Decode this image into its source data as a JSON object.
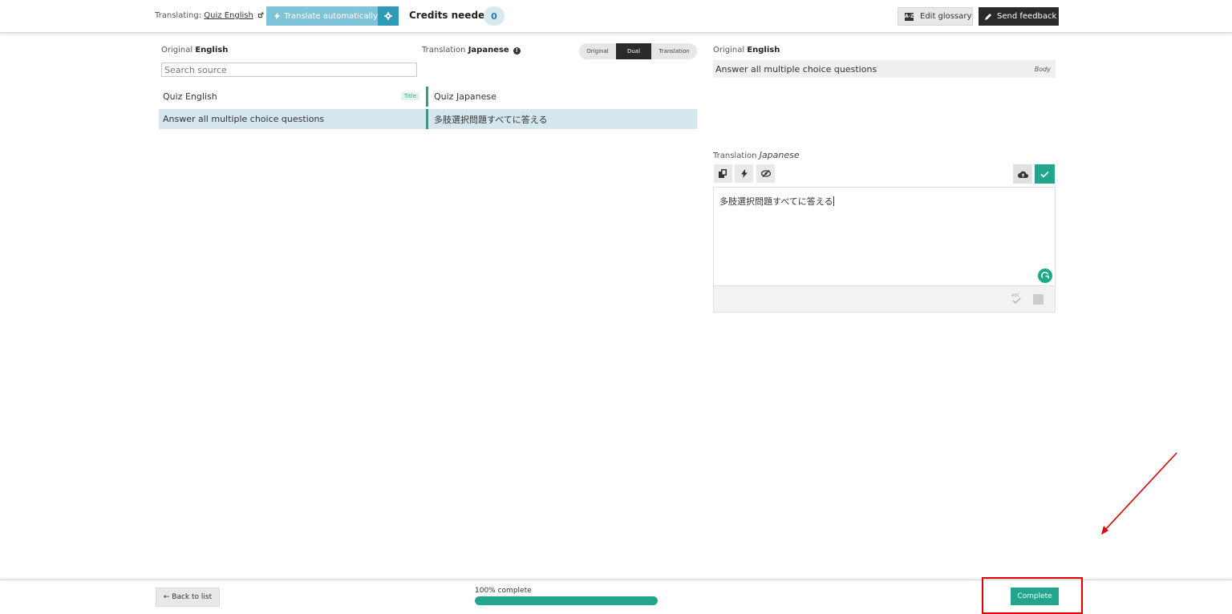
{
  "header": {
    "translating_label": "Translating:",
    "translating_link": "Quiz English",
    "translate_auto_label": "Translate automatically",
    "credits_label": "Credits needed",
    "credits_value": "0",
    "edit_glossary_label": "Edit glossary",
    "send_feedback_label": "Send feedback"
  },
  "left_panel": {
    "original_label": "Original",
    "original_lang": "English",
    "translation_label": "Translation",
    "translation_lang": "Japanese",
    "search_placeholder": "Search source",
    "view_toggle": {
      "options": [
        "Original",
        "Dual",
        "Translation"
      ],
      "selected": "Dual"
    },
    "rows": [
      {
        "source": "Quiz English",
        "tag": "Title",
        "target": "Quiz Japanese",
        "selected": false
      },
      {
        "source": "Answer all multiple choice questions",
        "tag": "",
        "target": "多肢選択問題すべてに答える",
        "selected": true
      }
    ]
  },
  "right_panel": {
    "original_label": "Original",
    "original_lang": "English",
    "original_text": "Answer all multiple choice questions",
    "field_type": "Body",
    "translation_label": "Translation",
    "translation_lang": "Japanese",
    "editor_text": "多肢選択問題すべてに答える"
  },
  "footer": {
    "back_label": "← Back to list",
    "progress_label": "100% complete",
    "progress_percent": 100,
    "complete_label": "Complete"
  },
  "colors": {
    "accent_teal": "#22a58d",
    "auto_blue": "#7ec3d8",
    "gear_blue": "#2f99b8",
    "selected_row": "#d6e6ef",
    "annotation_red": "#e00000"
  }
}
